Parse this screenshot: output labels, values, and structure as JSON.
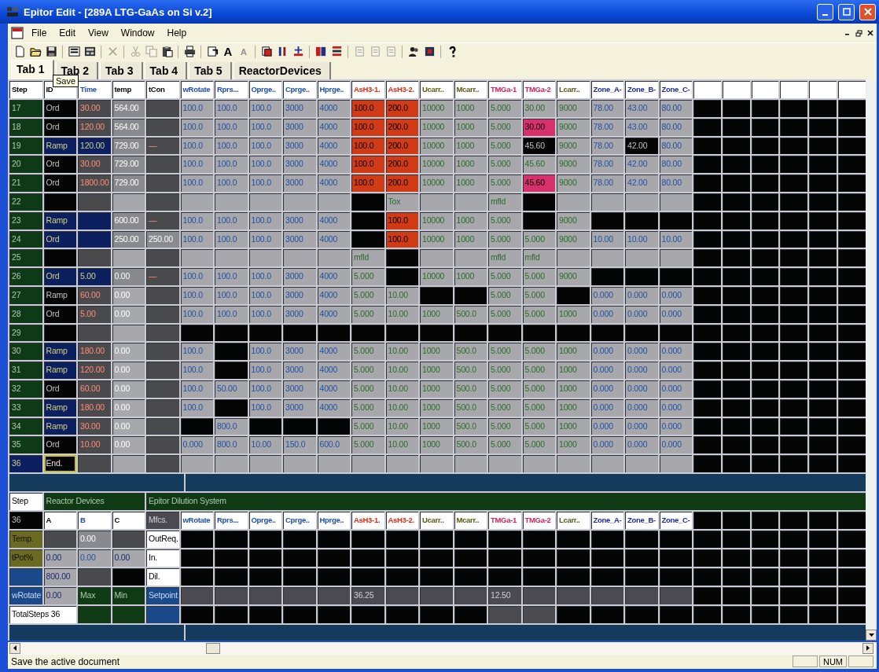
{
  "window": {
    "title": "Epitor Edit - [289A LTG-GaAs on Si v.2]"
  },
  "menu": [
    "File",
    "Edit",
    "View",
    "Window",
    "Help"
  ],
  "toolbar": [
    {
      "kind": "new",
      "disabled": false
    },
    {
      "kind": "open",
      "disabled": false
    },
    {
      "kind": "save",
      "disabled": false
    },
    {
      "kind": "sep"
    },
    {
      "kind": "form",
      "disabled": false
    },
    {
      "kind": "panel",
      "disabled": false
    },
    {
      "kind": "sep"
    },
    {
      "kind": "erase",
      "disabled": true
    },
    {
      "kind": "sep"
    },
    {
      "kind": "cut",
      "disabled": true
    },
    {
      "kind": "copy",
      "disabled": true
    },
    {
      "kind": "paste",
      "disabled": false
    },
    {
      "kind": "sep"
    },
    {
      "kind": "print",
      "disabled": false
    },
    {
      "kind": "sep"
    },
    {
      "kind": "refresh",
      "disabled": false
    },
    {
      "kind": "letter",
      "text": "A",
      "disabled": false
    },
    {
      "kind": "letter",
      "text": "A",
      "disabled": true
    },
    {
      "kind": "sep"
    },
    {
      "kind": "insert",
      "disabled": false
    },
    {
      "kind": "columns",
      "disabled": false
    },
    {
      "kind": "sparkle",
      "disabled": false
    },
    {
      "kind": "sep"
    },
    {
      "kind": "grid",
      "disabled": false
    },
    {
      "kind": "stack",
      "disabled": false
    },
    {
      "kind": "sep"
    },
    {
      "kind": "page",
      "disabled": true
    },
    {
      "kind": "page",
      "disabled": true
    },
    {
      "kind": "page",
      "disabled": true
    },
    {
      "kind": "sep"
    },
    {
      "kind": "person",
      "disabled": false
    },
    {
      "kind": "chip",
      "disabled": false
    },
    {
      "kind": "sep"
    },
    {
      "kind": "help",
      "disabled": false
    }
  ],
  "tabs": [
    {
      "label": "Tab 1",
      "selected": true
    },
    {
      "label": "Tab 2",
      "selected": false
    },
    {
      "label": "Tab 3",
      "selected": false
    },
    {
      "label": "Tab 4",
      "selected": false
    },
    {
      "label": "Tab 5",
      "selected": false
    },
    {
      "label": "ReactorDevices",
      "selected": false
    }
  ],
  "tooltip": "Save",
  "top_grid": {
    "columns": [
      {
        "label": "Step",
        "color": "#000000"
      },
      {
        "label": "ID",
        "color": "#000000"
      },
      {
        "label": "Time",
        "color": "#1e4fb0"
      },
      {
        "label": "temp",
        "color": "#000000"
      },
      {
        "label": "tCon",
        "color": "#000000"
      },
      {
        "label": "wRotate",
        "color": "#1e4fb0"
      },
      {
        "label": "Rprs...",
        "color": "#1e4fb0"
      },
      {
        "label": "Oprge..",
        "color": "#1e4fb0"
      },
      {
        "label": "Cprge..",
        "color": "#1e4fb0"
      },
      {
        "label": "Hprge..",
        "color": "#1e4fb0"
      },
      {
        "label": "AsH3-1.",
        "color": "#e02a10"
      },
      {
        "label": "AsH3-2.",
        "color": "#e02a10"
      },
      {
        "label": "Ucarr..",
        "color": "#5a5a10"
      },
      {
        "label": "Mcarr..",
        "color": "#5a5a10"
      },
      {
        "label": "TMGa-1",
        "color": "#d8205a"
      },
      {
        "label": "TMGa-2",
        "color": "#d8205a"
      },
      {
        "label": "Lcarr..",
        "color": "#5a5a10"
      },
      {
        "label": "Zone_A-",
        "color": "#1a2aa0"
      },
      {
        "label": "Zone_B-",
        "color": "#1a2aa0"
      },
      {
        "label": "Zone_C-",
        "color": "#1a2aa0"
      },
      {},
      {},
      {},
      {},
      {},
      {}
    ],
    "rows": [
      {
        "cells": [
          {
            "text": "17",
            "kind": "step"
          },
          {
            "text": "Ord",
            "kind": "black"
          },
          {
            "text": "30.00",
            "kind": "dim"
          },
          {
            "text": "564.00",
            "kind": "mid"
          },
          {
            "kind": "dim"
          },
          {
            "text": "100.0"
          },
          {
            "text": "100.0"
          },
          {
            "text": "100.0"
          },
          {
            "text": "3000"
          },
          {
            "text": "4000"
          },
          {
            "text": "100.0",
            "kind": "red"
          },
          {
            "text": "200.0",
            "kind": "red"
          },
          {
            "text": "10000"
          },
          {
            "text": "1000"
          },
          {
            "text": "5.000"
          },
          {
            "text": "30.00"
          },
          {
            "text": "9000"
          },
          {
            "text": "78.00"
          },
          {
            "text": "43.00"
          },
          {
            "text": "80.00"
          }
        ]
      },
      {
        "cells": [
          {
            "text": "18",
            "kind": "step"
          },
          {
            "text": "Ord",
            "kind": "black"
          },
          {
            "text": "120.00",
            "kind": "dim"
          },
          {
            "text": "564.00",
            "kind": "mid"
          },
          {
            "kind": "dim"
          },
          {
            "text": "100.0"
          },
          {
            "text": "100.0"
          },
          {
            "text": "100.0"
          },
          {
            "text": "3000"
          },
          {
            "text": "4000"
          },
          {
            "text": "100.0",
            "kind": "red"
          },
          {
            "text": "200.0",
            "kind": "red"
          },
          {
            "text": "10000"
          },
          {
            "text": "1000"
          },
          {
            "text": "5.000"
          },
          {
            "text": "30.00",
            "kind": "pink"
          },
          {
            "text": "9000"
          },
          {
            "text": "78.00"
          },
          {
            "text": "43.00"
          },
          {
            "text": "80.00"
          }
        ]
      },
      {
        "cells": [
          {
            "text": "19",
            "kind": "step"
          },
          {
            "text": "Ramp",
            "kind": "navy"
          },
          {
            "text": "120.00",
            "kind": "navy"
          },
          {
            "text": "729.00",
            "kind": "mid"
          },
          {
            "text": "—",
            "kind": "dim"
          },
          {
            "text": "100.0"
          },
          {
            "text": "100.0"
          },
          {
            "text": "100.0"
          },
          {
            "text": "3000"
          },
          {
            "text": "4000"
          },
          {
            "text": "100.0",
            "kind": "red"
          },
          {
            "text": "200.0",
            "kind": "red"
          },
          {
            "text": "10000"
          },
          {
            "text": "1000"
          },
          {
            "text": "5.000"
          },
          {
            "text": "45.60",
            "kind": "black"
          },
          {
            "text": "9000"
          },
          {
            "text": "78.00"
          },
          {
            "text": "42.00",
            "kind": "black"
          },
          {
            "text": "80.00"
          }
        ]
      },
      {
        "cells": [
          {
            "text": "20",
            "kind": "step"
          },
          {
            "text": "Ord",
            "kind": "black"
          },
          {
            "text": "30.00",
            "kind": "dim"
          },
          {
            "text": "729.00",
            "kind": "mid"
          },
          {
            "kind": "dim"
          },
          {
            "text": "100.0"
          },
          {
            "text": "100.0"
          },
          {
            "text": "100.0"
          },
          {
            "text": "3000"
          },
          {
            "text": "4000"
          },
          {
            "text": "100.0",
            "kind": "red"
          },
          {
            "text": "200.0",
            "kind": "red"
          },
          {
            "text": "10000"
          },
          {
            "text": "1000"
          },
          {
            "text": "5.000"
          },
          {
            "text": "45.60"
          },
          {
            "text": "9000"
          },
          {
            "text": "78.00"
          },
          {
            "text": "42.00"
          },
          {
            "text": "80.00"
          }
        ]
      },
      {
        "cells": [
          {
            "text": "21",
            "kind": "step"
          },
          {
            "text": "Ord",
            "kind": "black"
          },
          {
            "text": "1800.00",
            "kind": "dim"
          },
          {
            "text": "729.00",
            "kind": "mid"
          },
          {
            "kind": "dim"
          },
          {
            "text": "100.0"
          },
          {
            "text": "100.0"
          },
          {
            "text": "100.0"
          },
          {
            "text": "3000"
          },
          {
            "text": "4000"
          },
          {
            "text": "100.0",
            "kind": "red"
          },
          {
            "text": "200.0",
            "kind": "red"
          },
          {
            "text": "10000"
          },
          {
            "text": "1000"
          },
          {
            "text": "5.000"
          },
          {
            "text": "45.60",
            "kind": "pink"
          },
          {
            "text": "9000"
          },
          {
            "text": "78.00"
          },
          {
            "text": "42.00"
          },
          {
            "text": "80.00"
          }
        ]
      },
      {
        "cells": [
          {
            "text": "22",
            "kind": "step"
          },
          {
            "kind": "black"
          },
          {
            "kind": "dim"
          },
          {
            "kind": "grey"
          },
          {
            "kind": "dim"
          },
          {},
          {},
          {},
          {},
          {},
          {
            "kind": "black"
          },
          {
            "text": "Tox"
          },
          {},
          {},
          {
            "text": "mfld"
          },
          {
            "kind": "black"
          },
          {},
          {},
          {},
          {}
        ]
      },
      {
        "cells": [
          {
            "text": "23",
            "kind": "step"
          },
          {
            "text": "Ramp",
            "kind": "navy"
          },
          {
            "kind": "navy"
          },
          {
            "text": "600.00",
            "kind": "mid"
          },
          {
            "text": "—",
            "kind": "dim"
          },
          {
            "text": "100.0"
          },
          {
            "text": "100.0"
          },
          {
            "text": "100.0"
          },
          {
            "text": "3000"
          },
          {
            "text": "4000"
          },
          {
            "kind": "black"
          },
          {
            "text": "100.0",
            "kind": "red"
          },
          {
            "text": "10000"
          },
          {
            "text": "1000"
          },
          {
            "text": "5.000"
          },
          {
            "kind": "black"
          },
          {
            "text": "9000"
          },
          {
            "kind": "black"
          },
          {
            "kind": "black"
          },
          {
            "kind": "black"
          }
        ]
      },
      {
        "cells": [
          {
            "text": "24",
            "kind": "step"
          },
          {
            "text": "Ord",
            "kind": "navy"
          },
          {
            "kind": "navy"
          },
          {
            "text": "250.00",
            "kind": "mid"
          },
          {
            "text": "250.00",
            "kind": "mid"
          },
          {
            "text": "100.0"
          },
          {
            "text": "100.0"
          },
          {
            "text": "100.0"
          },
          {
            "text": "3000"
          },
          {
            "text": "4000"
          },
          {
            "kind": "black"
          },
          {
            "text": "100.0",
            "kind": "red"
          },
          {
            "text": "10000"
          },
          {
            "text": "1000"
          },
          {
            "text": "5.000"
          },
          {
            "text": "5.000"
          },
          {
            "text": "9000"
          },
          {
            "text": "10.00"
          },
          {
            "text": "10.00"
          },
          {
            "text": "10.00"
          }
        ]
      },
      {
        "cells": [
          {
            "text": "25",
            "kind": "step"
          },
          {
            "kind": "black"
          },
          {
            "kind": "dim"
          },
          {
            "kind": "grey"
          },
          {
            "kind": "dim"
          },
          {},
          {},
          {},
          {},
          {},
          {
            "text": "mfld"
          },
          {
            "kind": "black"
          },
          {},
          {},
          {
            "text": "mfld"
          },
          {
            "text": "mfld"
          },
          {},
          {},
          {},
          {}
        ]
      },
      {
        "cells": [
          {
            "text": "26",
            "kind": "step"
          },
          {
            "text": "Ord",
            "kind": "navy"
          },
          {
            "text": "5.00",
            "kind": "navy"
          },
          {
            "text": "0.00",
            "kind": "mid"
          },
          {
            "text": "—",
            "kind": "dim"
          },
          {
            "text": "100.0"
          },
          {
            "text": "100.0"
          },
          {
            "text": "100.0"
          },
          {
            "text": "3000"
          },
          {
            "text": "4000"
          },
          {
            "text": "5.000"
          },
          {
            "kind": "black"
          },
          {
            "text": "10000"
          },
          {
            "text": "1000"
          },
          {
            "text": "5.000"
          },
          {
            "text": "5.000"
          },
          {
            "text": "9000"
          },
          {
            "kind": "black"
          },
          {
            "kind": "black"
          },
          {
            "kind": "black"
          }
        ]
      },
      {
        "cells": [
          {
            "text": "27",
            "kind": "step"
          },
          {
            "text": "Ramp",
            "kind": "black"
          },
          {
            "text": "60.00",
            "kind": "dim"
          },
          {
            "text": "0.00",
            "kind": "pale"
          },
          {
            "kind": "dim"
          },
          {
            "text": "100.0"
          },
          {
            "text": "100.0"
          },
          {
            "text": "100.0"
          },
          {
            "text": "3000"
          },
          {
            "text": "4000"
          },
          {
            "text": "5.000"
          },
          {
            "text": "10.00"
          },
          {
            "kind": "black"
          },
          {
            "kind": "black"
          },
          {
            "text": "5.000"
          },
          {
            "text": "5.000"
          },
          {
            "kind": "black"
          },
          {
            "text": "0.000"
          },
          {
            "text": "0.000"
          },
          {
            "text": "0.000"
          }
        ]
      },
      {
        "cells": [
          {
            "text": "28",
            "kind": "step"
          },
          {
            "text": "Ord",
            "kind": "black"
          },
          {
            "text": "5.00",
            "kind": "dim"
          },
          {
            "text": "0.00",
            "kind": "pale"
          },
          {
            "kind": "dim"
          },
          {
            "text": "100.0"
          },
          {
            "text": "100.0"
          },
          {
            "text": "100.0"
          },
          {
            "text": "3000"
          },
          {
            "text": "4000"
          },
          {
            "text": "5.000"
          },
          {
            "text": "10.00"
          },
          {
            "text": "1000"
          },
          {
            "text": "500.0"
          },
          {
            "text": "5.000"
          },
          {
            "text": "5.000"
          },
          {
            "text": "1000"
          },
          {
            "text": "0.000"
          },
          {
            "text": "0.000"
          },
          {
            "text": "0.000"
          }
        ]
      },
      {
        "cells": [
          {
            "text": "29",
            "kind": "step"
          },
          {
            "kind": "black"
          },
          {
            "kind": "dim"
          },
          {
            "kind": "pale"
          },
          {
            "kind": "dim"
          },
          {
            "kind": "black"
          },
          {
            "kind": "black"
          },
          {
            "kind": "black"
          },
          {
            "kind": "black"
          },
          {
            "kind": "black"
          },
          {
            "kind": "black"
          },
          {
            "kind": "black"
          },
          {
            "kind": "black"
          },
          {
            "kind": "black"
          },
          {
            "kind": "black"
          },
          {
            "kind": "black"
          },
          {
            "kind": "black"
          },
          {
            "kind": "black"
          },
          {
            "kind": "black"
          },
          {
            "kind": "black"
          }
        ]
      },
      {
        "cells": [
          {
            "text": "30",
            "kind": "step"
          },
          {
            "text": "Ramp",
            "kind": "navy"
          },
          {
            "text": "180.00",
            "kind": "dim"
          },
          {
            "text": "0.00",
            "kind": "pale"
          },
          {
            "kind": "dim"
          },
          {
            "text": "100.0"
          },
          {
            "kind": "black"
          },
          {
            "text": "100.0"
          },
          {
            "text": "3000"
          },
          {
            "text": "4000"
          },
          {
            "text": "5.000"
          },
          {
            "text": "10.00"
          },
          {
            "text": "1000"
          },
          {
            "text": "500.0"
          },
          {
            "text": "5.000"
          },
          {
            "text": "5.000"
          },
          {
            "text": "1000"
          },
          {
            "text": "0.000"
          },
          {
            "text": "0.000"
          },
          {
            "text": "0.000"
          }
        ]
      },
      {
        "cells": [
          {
            "text": "31",
            "kind": "step"
          },
          {
            "text": "Ramp",
            "kind": "navy"
          },
          {
            "text": "120.00",
            "kind": "dim"
          },
          {
            "text": "0.00",
            "kind": "pale"
          },
          {
            "kind": "dim"
          },
          {
            "text": "100.0"
          },
          {
            "kind": "black"
          },
          {
            "text": "100.0"
          },
          {
            "text": "3000"
          },
          {
            "text": "4000"
          },
          {
            "text": "5.000"
          },
          {
            "text": "10.00"
          },
          {
            "text": "1000"
          },
          {
            "text": "500.0"
          },
          {
            "text": "5.000"
          },
          {
            "text": "5.000"
          },
          {
            "text": "1000"
          },
          {
            "text": "0.000"
          },
          {
            "text": "0.000"
          },
          {
            "text": "0.000"
          }
        ]
      },
      {
        "cells": [
          {
            "text": "32",
            "kind": "step"
          },
          {
            "text": "Ord",
            "kind": "black"
          },
          {
            "text": "60.00",
            "kind": "dim"
          },
          {
            "text": "0.00",
            "kind": "pale"
          },
          {
            "kind": "dim"
          },
          {
            "text": "100.0"
          },
          {
            "text": "50.00"
          },
          {
            "text": "100.0"
          },
          {
            "text": "3000"
          },
          {
            "text": "4000"
          },
          {
            "text": "5.000"
          },
          {
            "text": "10.00"
          },
          {
            "text": "1000"
          },
          {
            "text": "500.0"
          },
          {
            "text": "5.000"
          },
          {
            "text": "5.000"
          },
          {
            "text": "1000"
          },
          {
            "text": "0.000"
          },
          {
            "text": "0.000"
          },
          {
            "text": "0.000"
          }
        ]
      },
      {
        "cells": [
          {
            "text": "33",
            "kind": "step"
          },
          {
            "text": "Ramp",
            "kind": "navy"
          },
          {
            "text": "180.00",
            "kind": "dim"
          },
          {
            "text": "0.00",
            "kind": "pale"
          },
          {
            "kind": "dim"
          },
          {
            "text": "100.0"
          },
          {
            "kind": "black"
          },
          {
            "text": "100.0"
          },
          {
            "text": "3000"
          },
          {
            "text": "4000"
          },
          {
            "text": "5.000"
          },
          {
            "text": "10.00"
          },
          {
            "text": "1000"
          },
          {
            "text": "500.0"
          },
          {
            "text": "5.000"
          },
          {
            "text": "5.000"
          },
          {
            "text": "1000"
          },
          {
            "text": "0.000"
          },
          {
            "text": "0.000"
          },
          {
            "text": "0.000"
          }
        ]
      },
      {
        "cells": [
          {
            "text": "34",
            "kind": "step"
          },
          {
            "text": "Ramp",
            "kind": "navy"
          },
          {
            "text": "30.00",
            "kind": "dim"
          },
          {
            "text": "0.00",
            "kind": "pale"
          },
          {
            "kind": "dim"
          },
          {
            "kind": "black"
          },
          {
            "text": "800.0"
          },
          {
            "kind": "black"
          },
          {
            "kind": "black"
          },
          {
            "kind": "black"
          },
          {
            "text": "5.000"
          },
          {
            "text": "10.00"
          },
          {
            "text": "1000"
          },
          {
            "text": "500.0"
          },
          {
            "text": "5.000"
          },
          {
            "text": "5.000"
          },
          {
            "text": "1000"
          },
          {
            "text": "0.000"
          },
          {
            "text": "0.000"
          },
          {
            "text": "0.000"
          }
        ]
      },
      {
        "cells": [
          {
            "text": "35",
            "kind": "step"
          },
          {
            "text": "Ord",
            "kind": "black"
          },
          {
            "text": "10.00",
            "kind": "dim"
          },
          {
            "text": "0.00",
            "kind": "pale"
          },
          {
            "kind": "dim"
          },
          {
            "text": "0.000"
          },
          {
            "text": "800.0"
          },
          {
            "text": "10.00"
          },
          {
            "text": "150.0"
          },
          {
            "text": "600.0"
          },
          {
            "text": "5.000"
          },
          {
            "text": "10.00"
          },
          {
            "text": "1000"
          },
          {
            "text": "500.0"
          },
          {
            "text": "5.000"
          },
          {
            "text": "5.000"
          },
          {
            "text": "1000"
          },
          {
            "text": "0.000"
          },
          {
            "text": "0.000"
          },
          {
            "text": "0.000"
          }
        ]
      },
      {
        "cells": [
          {
            "text": "36",
            "kind": "navy"
          },
          {
            "text": "End.",
            "kind": "focus"
          },
          {
            "kind": "dim"
          },
          {
            "kind": "grey"
          },
          {
            "kind": "dim"
          },
          {},
          {},
          {},
          {},
          {},
          {},
          {},
          {},
          {},
          {},
          {},
          {},
          {},
          {},
          {}
        ]
      }
    ]
  },
  "bottom_grid": {
    "section_row": {
      "label": "Step",
      "groups": [
        "Reactor Devices",
        "Epitor Dilution System"
      ]
    },
    "rows": [
      {
        "cells": [
          {
            "text": "36",
            "kind": "black"
          },
          {
            "text": "A",
            "kind": "head"
          },
          {
            "text": "B",
            "kind": "head"
          },
          {
            "text": "C",
            "kind": "head"
          },
          {
            "text": "Mfcs.",
            "kind": "slate"
          },
          {
            "text": "wRotate",
            "kind": "head"
          },
          {
            "text": "Rprs...",
            "kind": "head"
          },
          {
            "text": "Oprge..",
            "kind": "head"
          },
          {
            "text": "Cprge..",
            "kind": "head"
          },
          {
            "text": "Hprge..",
            "kind": "head"
          },
          {
            "text": "AsH3-1.",
            "kind": "head"
          },
          {
            "text": "AsH3-2.",
            "kind": "head"
          },
          {
            "text": "Ucarr..",
            "kind": "head"
          },
          {
            "text": "Mcarr..",
            "kind": "head"
          },
          {
            "text": "TMGa-1",
            "kind": "head"
          },
          {
            "text": "TMGa-2",
            "kind": "head"
          },
          {
            "text": "Lcarr..",
            "kind": "head"
          },
          {
            "text": "Zone_A-",
            "kind": "head"
          },
          {
            "text": "Zone_B-",
            "kind": "head"
          },
          {
            "text": "Zone_C-",
            "kind": "head"
          }
        ]
      },
      {
        "cells": [
          {
            "text": "Temp.",
            "kind": "olive"
          },
          {
            "kind": "dim"
          },
          {
            "text": "0.00",
            "kind": "mid"
          },
          {
            "kind": "dim"
          },
          {
            "text": "OutReq.",
            "kind": "white"
          }
        ]
      },
      {
        "cells": [
          {
            "text": "tPot%",
            "kind": "olive"
          },
          {
            "text": "0.00"
          },
          {
            "text": "0.00"
          },
          {
            "text": "0.00"
          },
          {
            "text": "In.",
            "kind": "white"
          }
        ]
      },
      {
        "cells": [
          {
            "kind": "blue"
          },
          {
            "text": "800.00"
          },
          {
            "kind": "dim"
          },
          {
            "kind": "black"
          },
          {
            "text": "Dil.",
            "kind": "white"
          }
        ]
      },
      {
        "cells": [
          {
            "text": "wRotate",
            "kind": "blue"
          },
          {
            "text": "0.00"
          },
          {
            "text": "Max",
            "kind": "green"
          },
          {
            "text": "Min",
            "kind": "green"
          },
          {
            "text": "Setpoint",
            "kind": "blue"
          },
          {
            "kind": "slate"
          },
          {
            "kind": "slate"
          },
          {
            "kind": "slate"
          },
          {
            "kind": "slate"
          },
          {
            "kind": "slate"
          },
          {
            "text": "36.25",
            "kind": "slate"
          },
          {
            "kind": "slate"
          },
          {
            "kind": "slate"
          },
          {
            "kind": "slate"
          },
          {
            "text": "12.50",
            "kind": "slate"
          },
          {
            "kind": "slate"
          },
          {
            "kind": "slate"
          },
          {
            "kind": "slate"
          },
          {
            "kind": "slate"
          },
          {
            "kind": "slate"
          }
        ]
      },
      {
        "cells": [
          {
            "text": "TotalSteps 36",
            "kind": "wide"
          },
          {
            "kind": "green"
          },
          {
            "kind": "green"
          },
          {
            "kind": "blue"
          },
          {
            "kind": "black"
          },
          {
            "kind": "black"
          },
          {
            "kind": "black"
          },
          {
            "kind": "black"
          },
          {
            "kind": "black"
          },
          {
            "kind": "black"
          },
          {
            "kind": "black"
          },
          {
            "kind": "black"
          },
          {
            "kind": "black"
          },
          {
            "kind": "slate"
          },
          {
            "kind": "slate"
          }
        ]
      }
    ]
  },
  "status_bar": {
    "message": "Save the active document",
    "indicator": "NUM"
  }
}
